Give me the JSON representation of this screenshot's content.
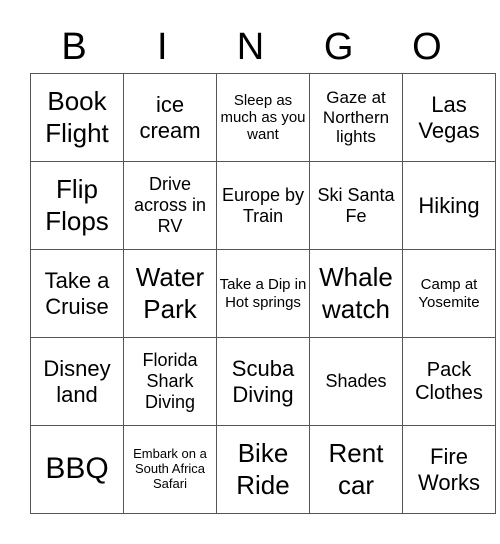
{
  "title_letters": [
    "B",
    "I",
    "N",
    "G",
    "O"
  ],
  "rows": [
    [
      "Book Flight",
      "ice cream",
      "Sleep as much as you want",
      "Gaze at Northern lights",
      "Las Vegas"
    ],
    [
      "Flip Flops",
      "Drive across in RV",
      "Europe by Train",
      "Ski Santa Fe",
      "Hiking"
    ],
    [
      "Take a Cruise",
      "Water Park",
      "Take a Dip in Hot springs",
      "Whale watch",
      "Camp at Yosemite"
    ],
    [
      "Disney land",
      "Florida Shark Diving",
      "Scuba Diving",
      "Shades",
      "Pack Clothes"
    ],
    [
      "BBQ",
      "Embark on a South Africa Safari",
      "Bike Ride",
      "Rent car",
      "Fire Works"
    ]
  ]
}
